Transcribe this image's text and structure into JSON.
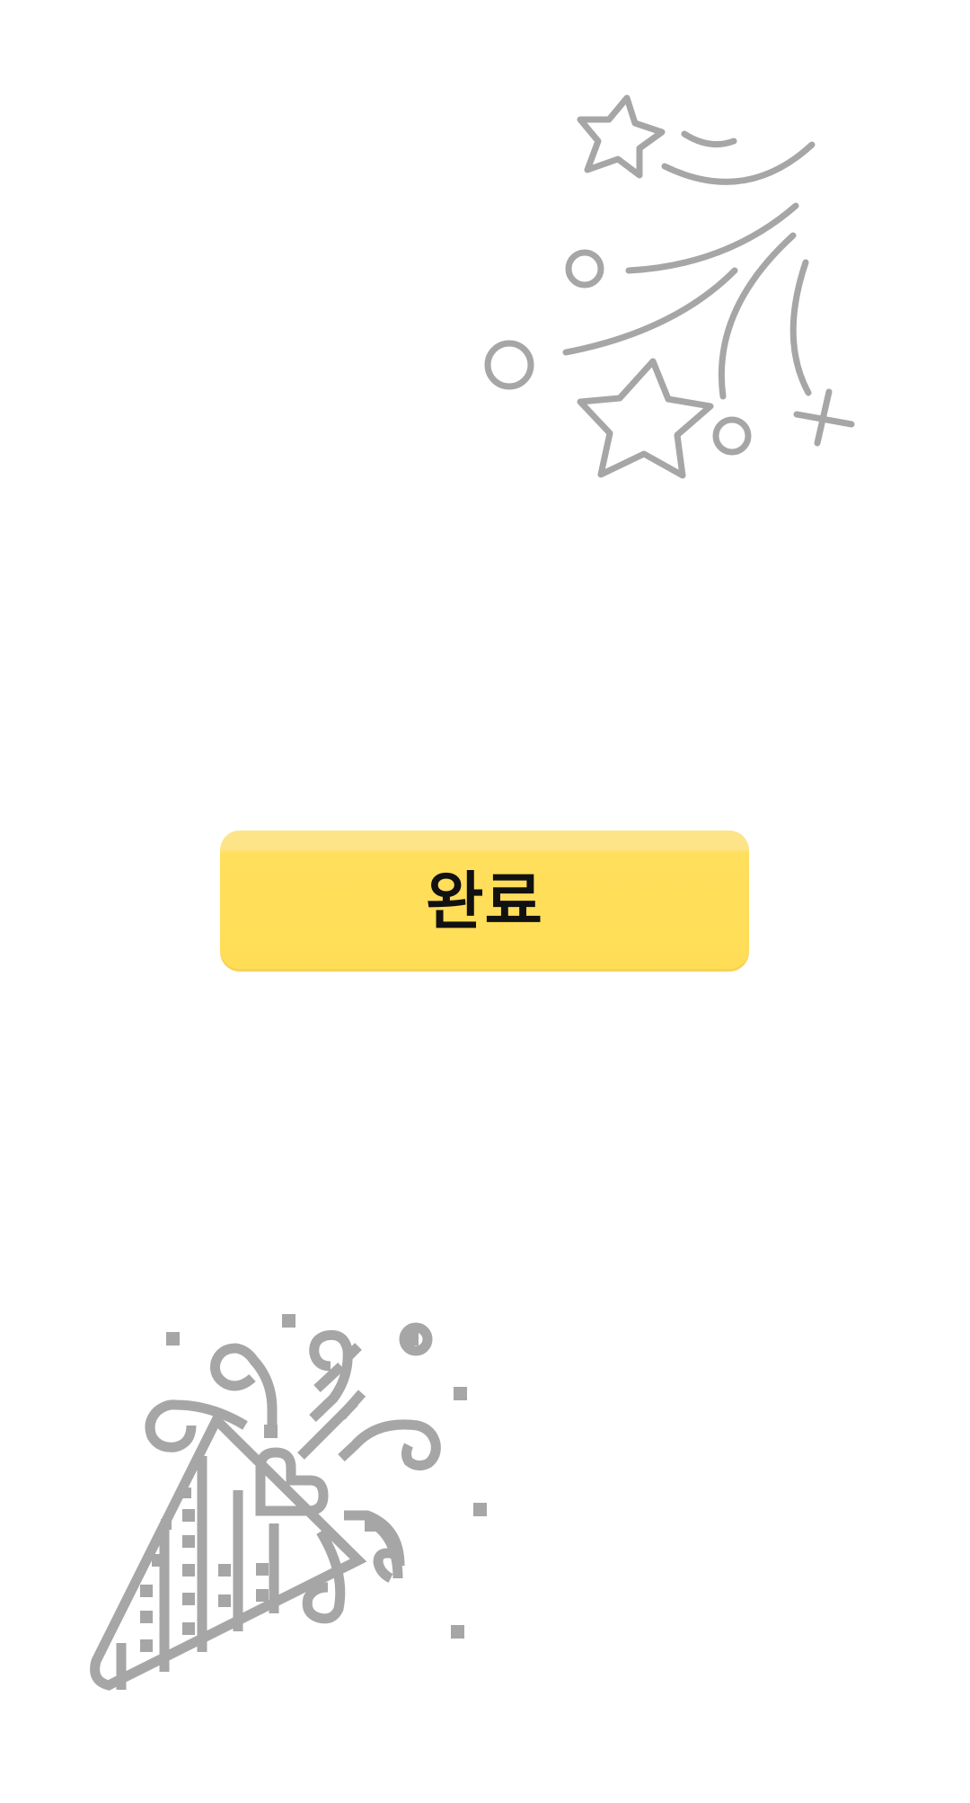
{
  "completion": {
    "done_label": "완료"
  },
  "icons": {
    "top": "fireworks-icon",
    "bottom": "party-popper-icon"
  },
  "colors": {
    "button_bg": "#ffdd57",
    "icon_stroke": "#a6a6a6",
    "label": "#111111",
    "background": "#ffffff"
  }
}
